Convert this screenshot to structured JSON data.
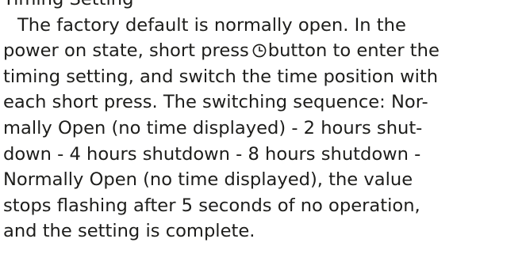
{
  "manual": {
    "heading_partial": "Timing Setting",
    "lines": [
      "The factory default is normally open. In the",
      "power on state, short press",
      "button to enter the",
      "timing setting, and switch the time position with",
      "each short press. The switching sequence: Nor-",
      "mally Open (no time displayed) - 2 hours shut-",
      "down - 4 hours shutdown - 8 hours shutdown -",
      "Normally Open (no time displayed), the value",
      "stops flashing after 5 seconds of no operation,",
      "and the setting is complete."
    ],
    "icon": "clock-icon",
    "text_color": "#1d1d1b"
  }
}
